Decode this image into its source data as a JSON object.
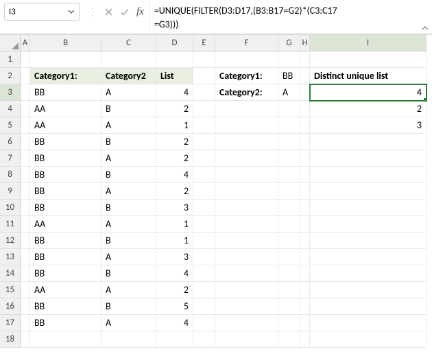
{
  "namebox": {
    "ref": "I3"
  },
  "fx_label": "fx",
  "formula": {
    "line1": "=UNIQUE(FILTER(D3:D17,(B3:B17=G2)*(C3:C17",
    "line2": "=G3)))"
  },
  "columns": [
    "A",
    "B",
    "C",
    "D",
    "E",
    "F",
    "G",
    "H",
    "I"
  ],
  "rows": [
    "1",
    "2",
    "3",
    "4",
    "5",
    "6",
    "7",
    "8",
    "9",
    "10",
    "11",
    "12",
    "13",
    "14",
    "15",
    "16",
    "17",
    "18"
  ],
  "active": {
    "col": "I",
    "row": "3"
  },
  "headers": {
    "B": "Category1:",
    "C": "Category2",
    "D": "List",
    "F2": "Category1:",
    "F3": "Category2:",
    "I": "Distinct unique list"
  },
  "criteria": {
    "G2": "BB",
    "G3": "A"
  },
  "result": {
    "I3": "4",
    "I4": "2",
    "I5": "3"
  },
  "chart_data": {
    "type": "table",
    "columns": [
      "Category1",
      "Category2",
      "List"
    ],
    "rows": [
      [
        "BB",
        "A",
        4
      ],
      [
        "AA",
        "B",
        2
      ],
      [
        "AA",
        "A",
        1
      ],
      [
        "BB",
        "B",
        2
      ],
      [
        "BB",
        "A",
        2
      ],
      [
        "BB",
        "B",
        4
      ],
      [
        "BB",
        "A",
        2
      ],
      [
        "BB",
        "B",
        3
      ],
      [
        "AA",
        "A",
        1
      ],
      [
        "BB",
        "B",
        1
      ],
      [
        "BB",
        "A",
        3
      ],
      [
        "BB",
        "B",
        4
      ],
      [
        "AA",
        "A",
        2
      ],
      [
        "BB",
        "B",
        5
      ],
      [
        "BB",
        "A",
        4
      ]
    ]
  }
}
